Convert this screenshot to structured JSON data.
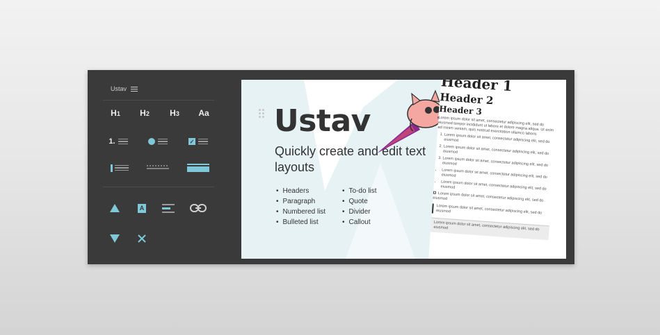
{
  "sidebar": {
    "brand": "Ustav",
    "headings": [
      {
        "main": "H",
        "sub": "1"
      },
      {
        "main": "H",
        "sub": "2"
      },
      {
        "main": "H",
        "sub": "3"
      },
      {
        "main": "Aa",
        "sub": ""
      }
    ],
    "list_labels": {
      "numbered": "1."
    }
  },
  "card": {
    "title": "Ustav",
    "subtitle": "Quickly create and edit text layouts",
    "features_left": [
      "Headers",
      "Paragraph",
      "Numbered list",
      "Bulleted list"
    ],
    "features_right": [
      "To-do list",
      "Quote",
      "Divider",
      "Callout"
    ]
  },
  "doc": {
    "h1": "Header 1",
    "h2": "Header 2",
    "h3": "Header 3",
    "paragraph": "Lorem ipsum dolor sit amet, consectetur adipiscing elit, sed do eiusmod tempor incididunt ut labore et dolore magna aliqua. Ut enim ad minim veniam, quis nostrud exercitation ullamco laboris",
    "numbered": [
      "Lorem ipsum dolor sit amet, consectetur adipiscing elit, sed do eiusmod",
      "Lorem ipsum dolor sit amet, consectetur adipiscing elit, sed do eiusmod",
      "Lorem ipsum dolor sit amet, consectetur adipiscing elit, sed do eiusmod"
    ],
    "bulleted": [
      "Lorem ipsum dolor sit amet, consectetur adipiscing elit, sed do eiusmod",
      "Lorem ipsum dolor sit amet, consectetur adipiscing elit, sed do eiusmod"
    ],
    "todo": "Lorem ipsum dolor sit amet, consectetur adipiscing elit, sed do eiusmod",
    "quote": "Lorem ipsum dolor sit amet, consectetur adipiscing elit, sed do eiusmod",
    "callout": "Lorem ipsum dolor sit amet, consectetur adipiscing elit, sed do eiusmod"
  },
  "colors": {
    "frame": "#3a3a3a",
    "accent": "#7ec8d9",
    "icon": "#ededed",
    "rocket": "#8a2a8f",
    "character": "#f3a7a0",
    "hand": "#f7e23a"
  }
}
